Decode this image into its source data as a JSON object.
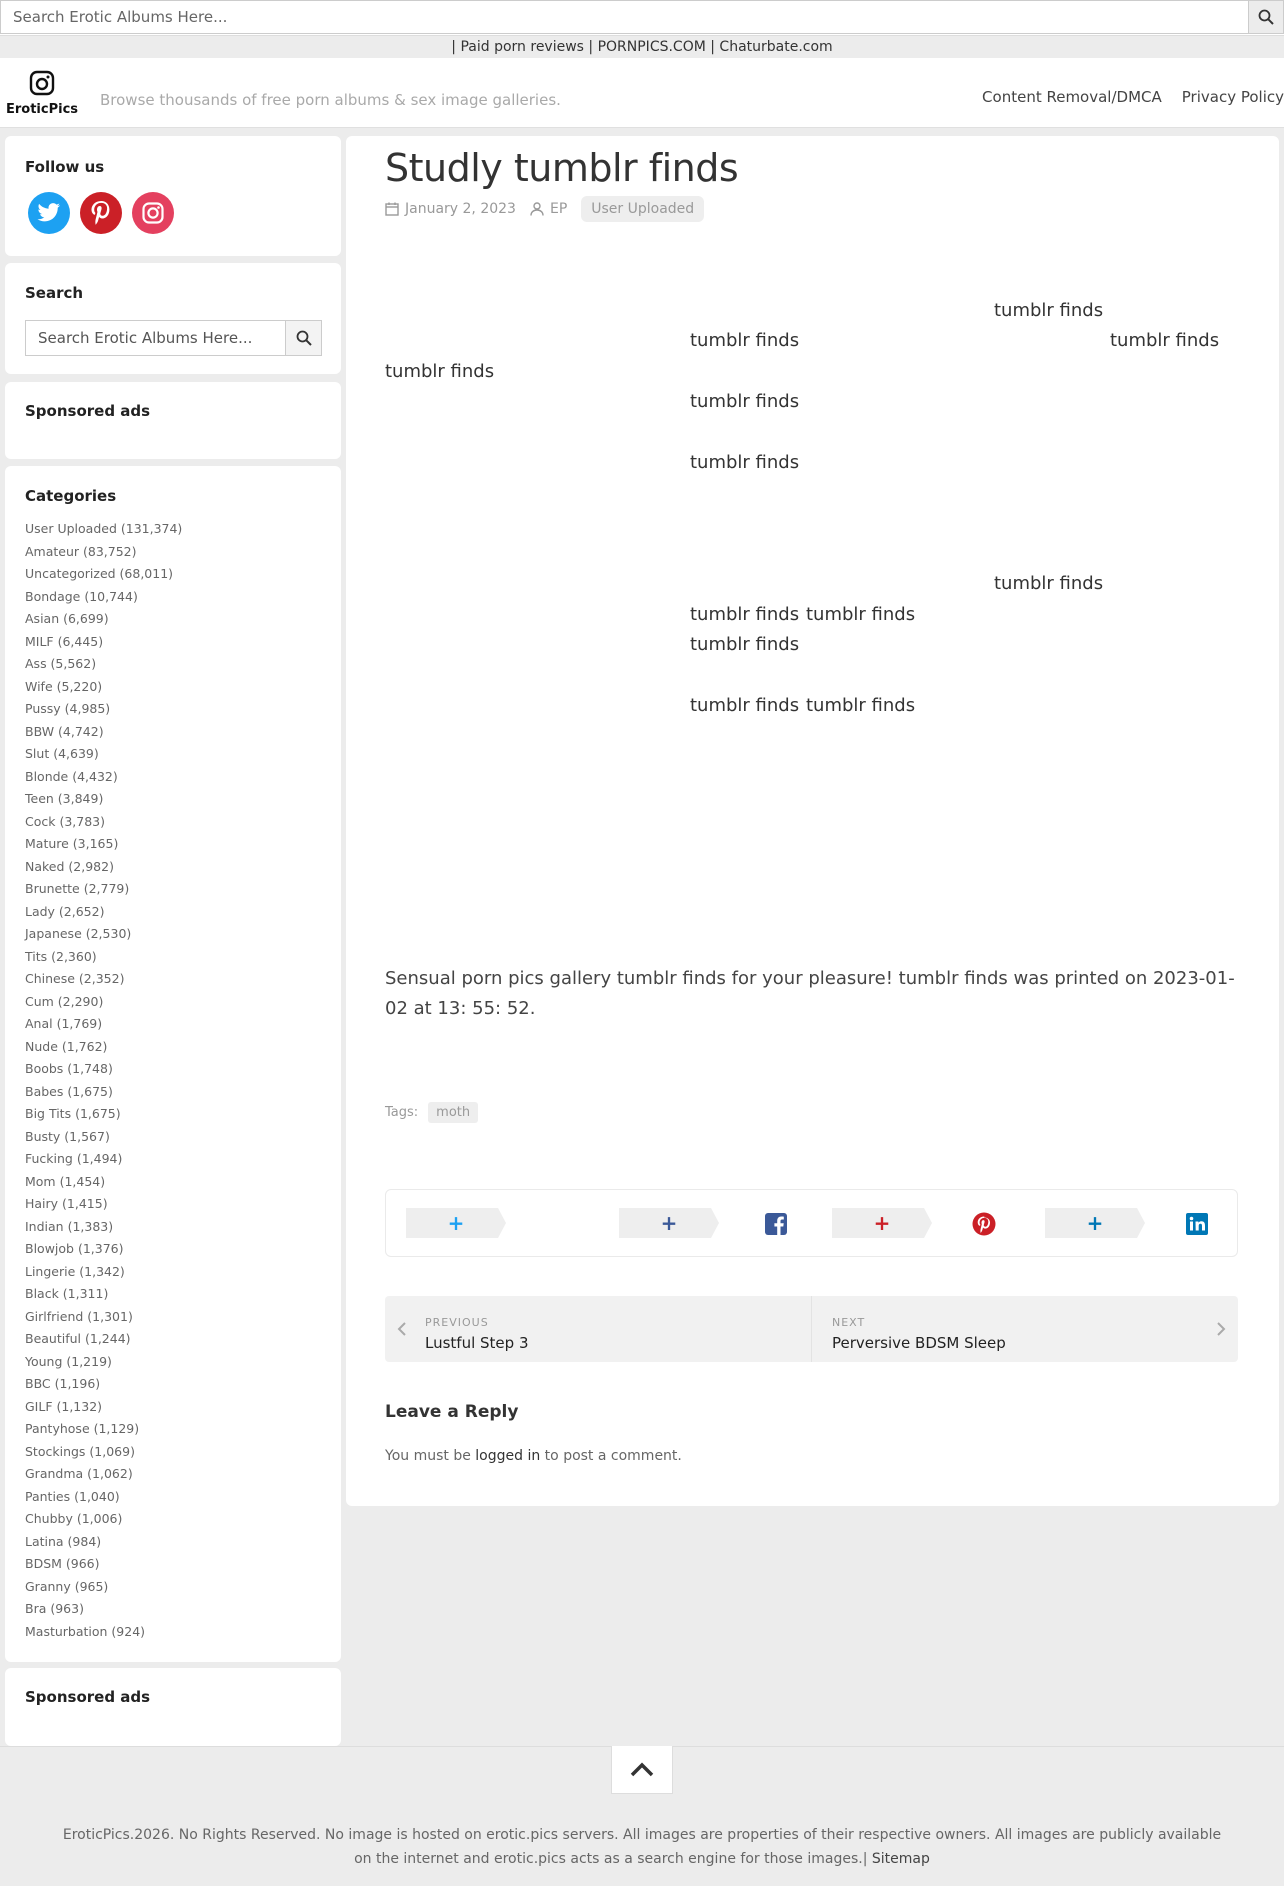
{
  "top_search": {
    "placeholder": "Search Erotic Albums Here..."
  },
  "links_bar": {
    "text": "| Paid porn reviews | PORNPICS.COM | Chaturbate.com"
  },
  "header": {
    "logo_text": "EroticPics",
    "tagline": "Browse thousands of free porn albums & sex image galleries.",
    "nav": [
      "Content Removal/DMCA",
      "Privacy Policy"
    ]
  },
  "sidebar": {
    "follow_title": "Follow us",
    "social": [
      "twitter-icon",
      "pinterest-icon",
      "instagram-icon"
    ],
    "search_title": "Search",
    "search_placeholder": "Search Erotic Albums Here...",
    "sponsored_title": "Sponsored ads",
    "categories_title": "Categories",
    "categories": [
      "User Uploaded (131,374)",
      "Amateur (83,752)",
      "Uncategorized (68,011)",
      "Bondage (10,744)",
      "Asian (6,699)",
      "MILF (6,445)",
      "Ass (5,562)",
      "Wife (5,220)",
      "Pussy (4,985)",
      "BBW (4,742)",
      "Slut (4,639)",
      "Blonde (4,432)",
      "Teen (3,849)",
      "Cock (3,783)",
      "Mature (3,165)",
      "Naked (2,982)",
      "Brunette (2,779)",
      "Lady (2,652)",
      "Japanese (2,530)",
      "Tits (2,360)",
      "Chinese (2,352)",
      "Cum (2,290)",
      "Anal (1,769)",
      "Nude (1,762)",
      "Boobs (1,748)",
      "Babes (1,675)",
      "Big Tits (1,675)",
      "Busty (1,567)",
      "Fucking (1,494)",
      "Mom (1,454)",
      "Hairy (1,415)",
      "Indian (1,383)",
      "Blowjob (1,376)",
      "Lingerie (1,342)",
      "Black (1,311)",
      "Girlfriend (1,301)",
      "Beautiful (1,244)",
      "Young (1,219)",
      "BBC (1,196)",
      "GILF (1,132)",
      "Pantyhose (1,129)",
      "Stockings (1,069)",
      "Grandma (1,062)",
      "Panties (1,040)",
      "Chubby (1,006)",
      "Latina (984)",
      "BDSM (966)",
      "Granny (965)",
      "Bra (963)",
      "Masturbation (924)"
    ],
    "sponsored_title_2": "Sponsored ads"
  },
  "post": {
    "title": "Studly tumblr finds",
    "date": "January 2, 2023",
    "author": "EP",
    "category": "User Uploaded",
    "image_alt": "tumblr finds",
    "description": "Sensual porn pics gallery tumblr finds for your pleasure! tumblr finds was printed on 2023-01-02 at 13: 55: 52.",
    "tags_label": "Tags:",
    "tag": "moth",
    "share_plus": "+",
    "prev_label": "PREVIOUS",
    "prev_title": "Lustful Step 3",
    "next_label": "NEXT",
    "next_title": "Perversive BDSM Sleep",
    "reply_title": "Leave a Reply",
    "reply_pre": "You must be ",
    "reply_link": "logged in",
    "reply_post": " to post a comment."
  },
  "footer": {
    "copyright": "EroticPics.2026. No Rights Reserved. No image is hosted on erotic.pics servers. All images are properties of their respective owners. All images are publicly available on the internet and erotic.pics acts as a search engine for those images.|",
    "sitemap": "Sitemap"
  },
  "colors": {
    "twitter": "#1da1f2",
    "pinterest": "#cb2027",
    "instagram": "#e4405f",
    "facebook": "#3b5998",
    "linkedin": "#0077b5"
  }
}
